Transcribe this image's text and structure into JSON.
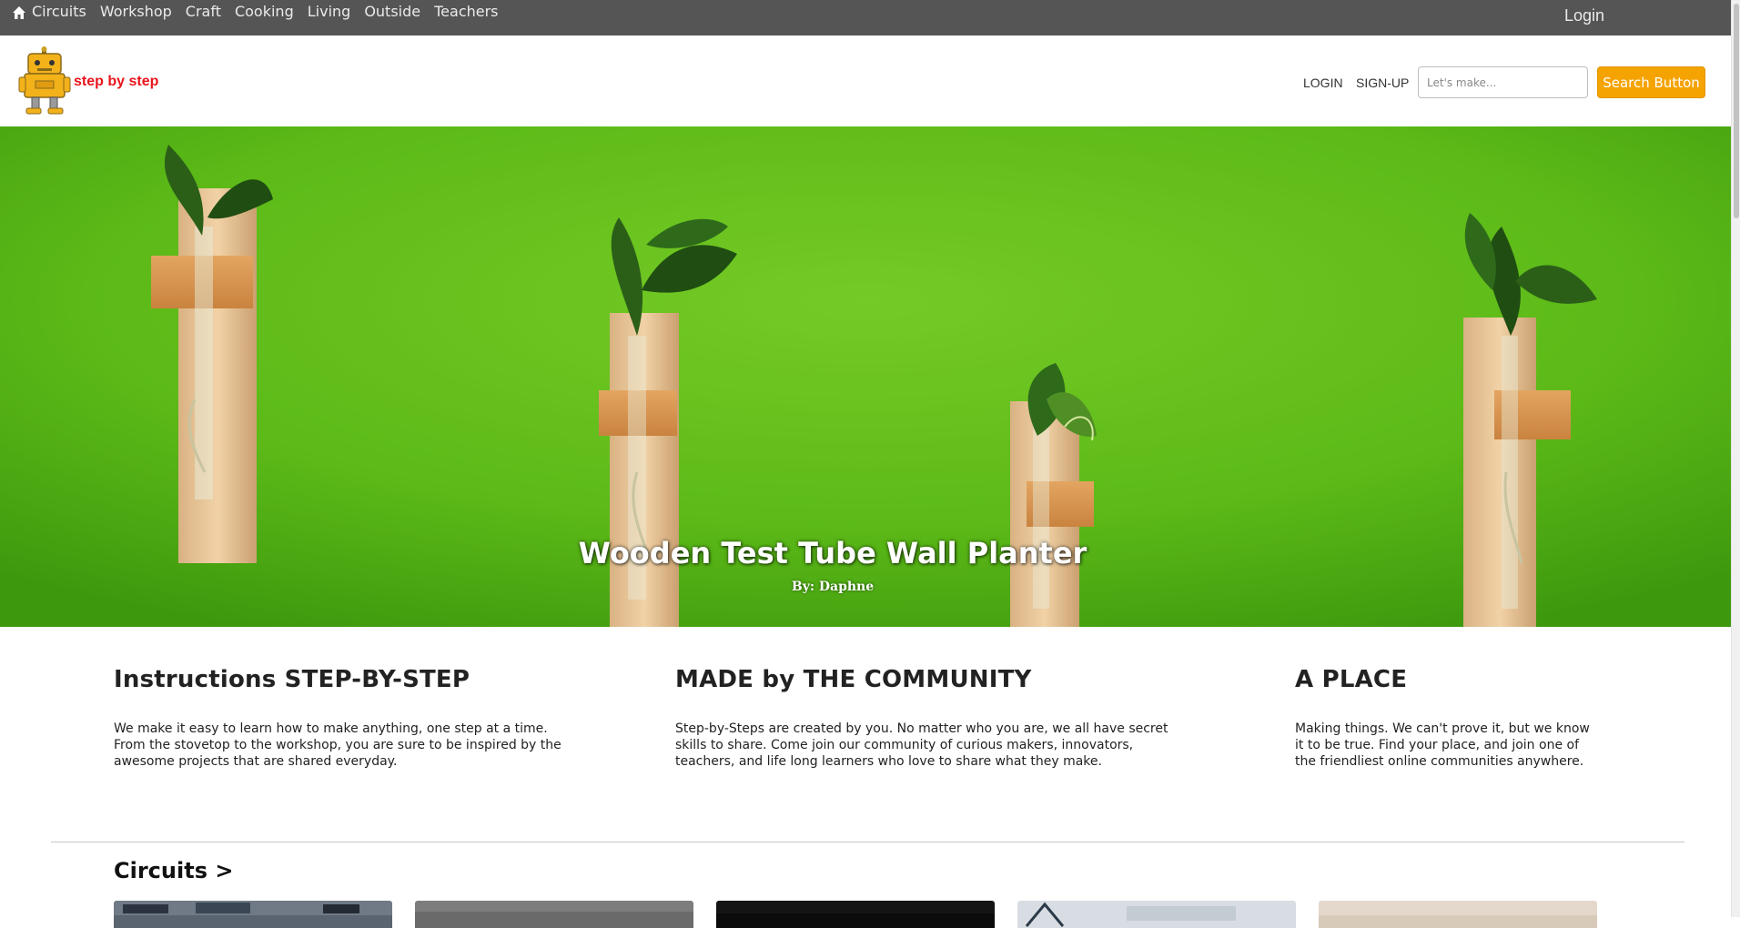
{
  "topbar": {
    "nav_items": [
      "Circuits",
      "Workshop",
      "Craft",
      "Cooking",
      "Living",
      "Outside",
      "Teachers"
    ],
    "login": "Login"
  },
  "header": {
    "brand": "step by step",
    "login_link": "LOGIN",
    "signup_link": "SIGN-UP",
    "search_placeholder": "Let's make...",
    "search_button": "Search Button",
    "accent_color": "#f5a300",
    "brand_color": "#e8141b"
  },
  "hero": {
    "title": "Wooden Test Tube Wall Planter",
    "author": "By: Daphne"
  },
  "info": [
    {
      "title": "Instructions STEP-BY-STEP",
      "text": "We make it easy to learn how to make anything, one step at a time. From the stovetop to the workshop, you are sure to be inspired by the awesome projects that are shared everyday."
    },
    {
      "title": "MADE by THE COMMUNITY",
      "text": "Step-by-Steps are created by you. No matter who you are, we all have secret skills to share. Come join our community of curious makers, innovators, teachers, and life long learners who love to share what they make."
    },
    {
      "title": "A PLACE",
      "text": "Making things. We can't prove it, but we know it to be true. Find your place, and join one of the friendliest online communities anywhere."
    }
  ],
  "section": {
    "title": "Circuits >"
  }
}
